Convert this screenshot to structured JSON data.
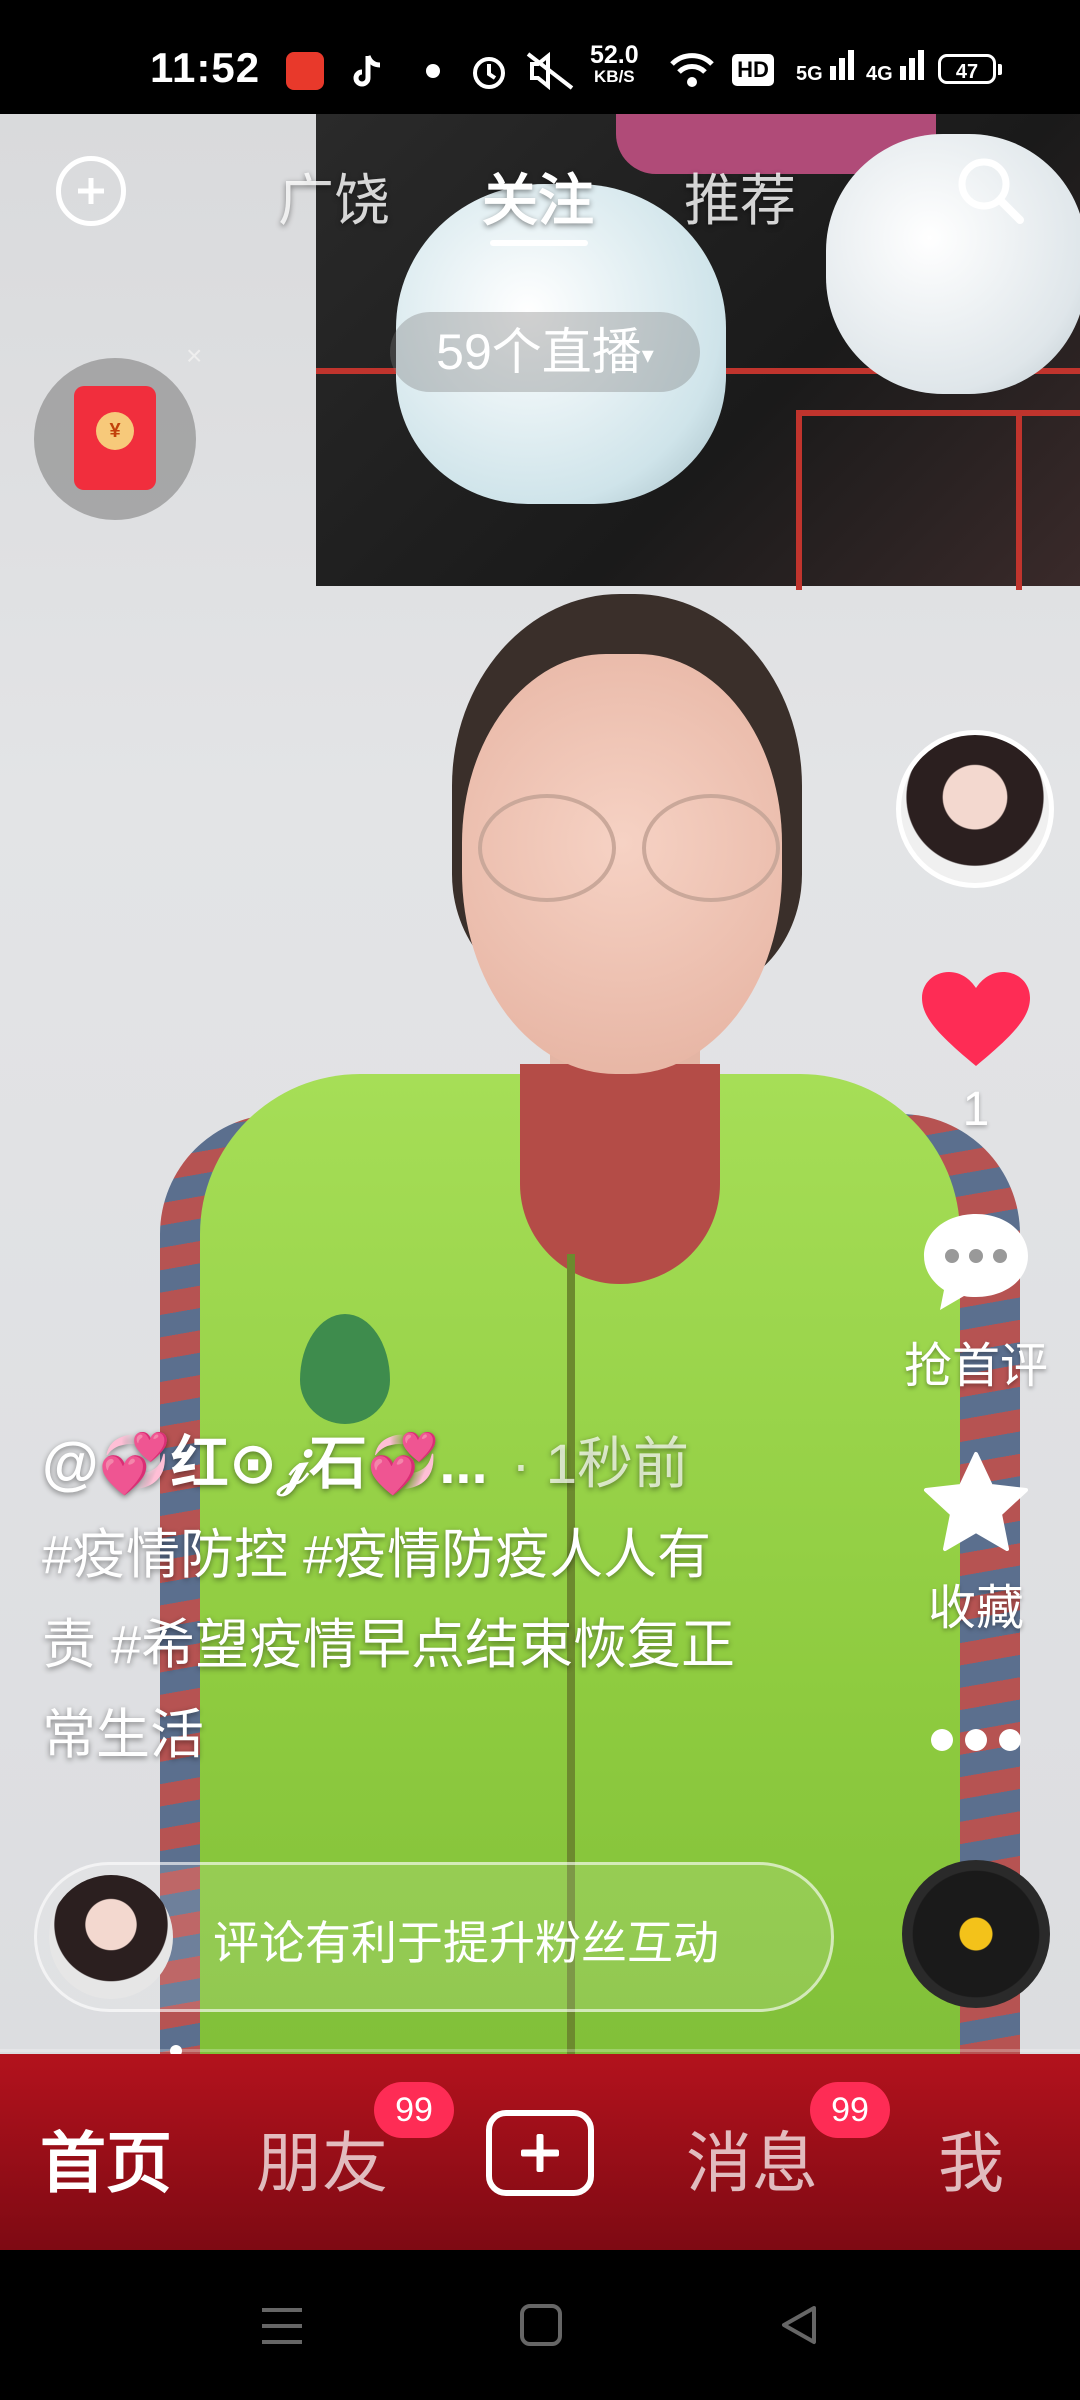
{
  "status_bar": {
    "time": "11:52",
    "net_speed_value": "52.0",
    "net_speed_unit": "KB/S",
    "hd_label": "HD",
    "signal1_label": "5G",
    "signal2_label": "4G",
    "battery": "47"
  },
  "top_nav": {
    "tabs": [
      {
        "label": "广饶",
        "active": false
      },
      {
        "label": "关注",
        "active": true
      },
      {
        "label": "推荐",
        "active": false
      }
    ],
    "live_count_label": "59个直播",
    "live_caret": "▾"
  },
  "red_packet": {
    "coin_symbol": "¥",
    "close_glyph": "×"
  },
  "sidebar": {
    "like_count": "1",
    "comment_label": "抢首评",
    "favorite_label": "收藏"
  },
  "post": {
    "author": "@💞红⊙𝒿石💞...",
    "time_ago": "· 1秒前",
    "description": "#疫情防控 #疫情防疫人人有责 #希望疫情早点结束恢复正常生活"
  },
  "comment_bar": {
    "prompt": "评论有利于提升粉丝互动"
  },
  "bottom_tabs": {
    "home": "首页",
    "friends": "朋友",
    "friends_badge": "99",
    "messages": "消息",
    "messages_badge": "99",
    "me": "我"
  },
  "colors": {
    "tab_bar_bg": "#b3121d",
    "badge": "#fe2c55",
    "heart": "#fe2c55",
    "red_packet": "#f12e3d"
  }
}
